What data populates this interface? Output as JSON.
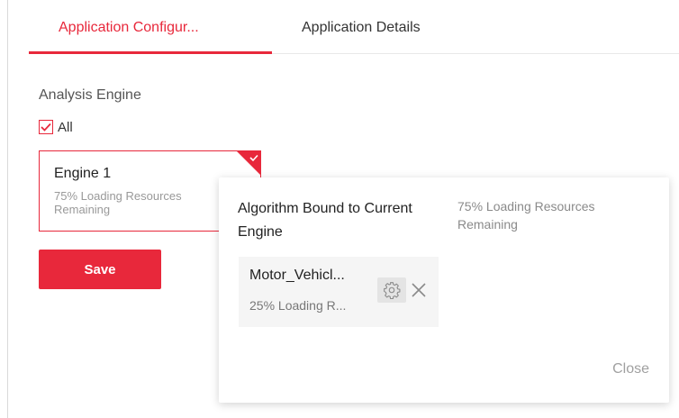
{
  "tabs": [
    {
      "label": "Application Configur...",
      "active": true
    },
    {
      "label": "Application Details",
      "active": false
    }
  ],
  "analysis": {
    "label": "Analysis Engine",
    "all_label": "All",
    "all_checked": true
  },
  "engine": {
    "name": "Engine 1",
    "meta": "75% Loading Resources Remaining",
    "selected": true
  },
  "save_label": "Save",
  "popup": {
    "title": "Algorithm Bound to Current Engine",
    "remaining": "75% Loading Resources Remaining",
    "algorithm": {
      "name": "Motor_Vehicl...",
      "meta": "25% Loading R..."
    },
    "close_label": "Close"
  },
  "colors": {
    "accent": "#e8283b",
    "muted": "#999999"
  },
  "icons": [
    "check-icon",
    "gear-icon",
    "close-icon"
  ]
}
